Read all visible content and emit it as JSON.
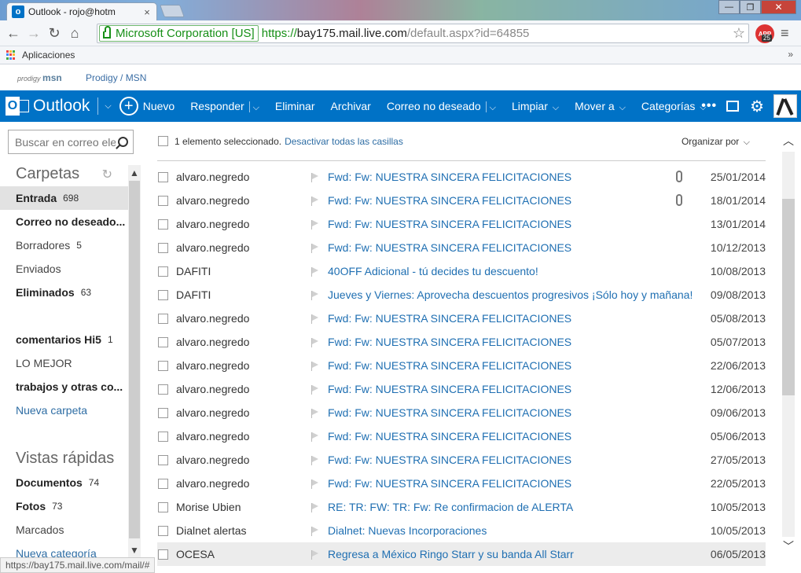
{
  "browser": {
    "tab_title": "Outlook -     rojo@hotm",
    "tab_close": "×",
    "window_controls": {
      "minimize": "—",
      "maximize": "❐",
      "close": "✕"
    },
    "nav": {
      "back": "←",
      "forward": "→",
      "reload": "↻",
      "home": "⌂"
    },
    "ev_label": "Microsoft Corporation [US]",
    "url_scheme": "https://",
    "url_host": "bay175.mail.live.com",
    "url_path": "/default.aspx?id=64855",
    "star": "☆",
    "ext_label": "APP",
    "ext_badge": "25",
    "menu": "≡",
    "bookmarks_apps": "Aplicaciones",
    "bookmarks_overflow": "»",
    "status_url": "https://bay175.mail.live.com/mail/#"
  },
  "portal": {
    "logo_small": "prodigy",
    "logo_brand": "msn",
    "link": "Prodigy / MSN"
  },
  "outlook": {
    "brand": "Outlook",
    "new_label": "Nuevo",
    "commands": [
      {
        "label": "Responder",
        "split": true
      },
      {
        "label": "Eliminar",
        "split": false
      },
      {
        "label": "Archivar",
        "split": false
      },
      {
        "label": "Correo no deseado",
        "split": true
      },
      {
        "label": "Limpiar",
        "split": false,
        "dropdown": true
      },
      {
        "label": "Mover a",
        "split": false,
        "dropdown": true
      },
      {
        "label": "Categorías",
        "split": false,
        "dropdown": true
      }
    ],
    "more": "•••",
    "gear": "⚙"
  },
  "sidebar": {
    "search_placeholder": "Buscar en correo electrónico",
    "folders_title": "Carpetas",
    "refresh": "↻",
    "folders": [
      {
        "label": "Entrada",
        "count": "698",
        "style": "sel"
      },
      {
        "label": "Correo no deseado...",
        "count": "",
        "style": "bold"
      },
      {
        "label": "Borradores",
        "count": "5",
        "style": ""
      },
      {
        "label": "Enviados",
        "count": "",
        "style": ""
      },
      {
        "label": "Eliminados",
        "count": "63",
        "style": "bold"
      }
    ],
    "custom_folders": [
      {
        "label": "comentarios Hi5",
        "count": "1",
        "style": "bold"
      },
      {
        "label": "LO MEJOR",
        "count": "",
        "style": ""
      },
      {
        "label": "trabajos y otras co...",
        "count": "",
        "style": "bold"
      }
    ],
    "new_folder": "Nueva carpeta",
    "quick_views_title": "Vistas rápidas",
    "quick_views": [
      {
        "label": "Documentos",
        "count": "74",
        "style": "bold"
      },
      {
        "label": "Fotos",
        "count": "73",
        "style": "bold"
      },
      {
        "label": "Marcados",
        "count": "",
        "style": ""
      }
    ],
    "new_category": "Nueva categoría",
    "scroll_up": "▲",
    "scroll_down": "▼"
  },
  "list": {
    "selection_text": "1 elemento seleccionado.",
    "deselect_link": "Desactivar todas las casillas",
    "organize_label": "Organizar por",
    "scroll_up": "︿",
    "scroll_down": "﹀",
    "rows": [
      {
        "from": "alvaro.negredo",
        "subject": "Fwd: Fw: NUESTRA SINCERA FELICITACIONES",
        "date": "25/01/2014",
        "attachment": true
      },
      {
        "from": "alvaro.negredo",
        "subject": "Fwd: Fw: NUESTRA SINCERA FELICITACIONES",
        "date": "18/01/2014",
        "attachment": true
      },
      {
        "from": "alvaro.negredo",
        "subject": "Fwd: Fw: NUESTRA SINCERA FELICITACIONES",
        "date": "13/01/2014",
        "attachment": false
      },
      {
        "from": "alvaro.negredo",
        "subject": "Fwd: Fw: NUESTRA SINCERA FELICITACIONES",
        "date": "10/12/2013",
        "attachment": false
      },
      {
        "from": "DAFITI",
        "subject": "40OFF Adicional - tú decides tu descuento!",
        "date": "10/08/2013",
        "attachment": false
      },
      {
        "from": "DAFITI",
        "subject": "Jueves y Viernes: Aprovecha descuentos progresivos ¡Sólo hoy y mañana!",
        "date": "09/08/2013",
        "attachment": false
      },
      {
        "from": "alvaro.negredo",
        "subject": "Fwd: Fw: NUESTRA SINCERA FELICITACIONES",
        "date": "05/08/2013",
        "attachment": false
      },
      {
        "from": "alvaro.negredo",
        "subject": "Fwd: Fw: NUESTRA SINCERA FELICITACIONES",
        "date": "05/07/2013",
        "attachment": false
      },
      {
        "from": "alvaro.negredo",
        "subject": "Fwd: Fw: NUESTRA SINCERA FELICITACIONES",
        "date": "22/06/2013",
        "attachment": false
      },
      {
        "from": "alvaro.negredo",
        "subject": "Fwd: Fw: NUESTRA SINCERA FELICITACIONES",
        "date": "12/06/2013",
        "attachment": false
      },
      {
        "from": "alvaro.negredo",
        "subject": "Fwd: Fw: NUESTRA SINCERA FELICITACIONES",
        "date": "09/06/2013",
        "attachment": false
      },
      {
        "from": "alvaro.negredo",
        "subject": "Fwd: Fw: NUESTRA SINCERA FELICITACIONES",
        "date": "05/06/2013",
        "attachment": false
      },
      {
        "from": "alvaro.negredo",
        "subject": "Fwd: Fw: NUESTRA SINCERA FELICITACIONES",
        "date": "27/05/2013",
        "attachment": false
      },
      {
        "from": "alvaro.negredo",
        "subject": "Fwd: Fw: NUESTRA SINCERA FELICITACIONES",
        "date": "22/05/2013",
        "attachment": false
      },
      {
        "from": "Morise Ubien",
        "subject": "RE: TR: FW: TR: Fw: Re confirmacion de ALERTA",
        "date": "10/05/2013",
        "attachment": false
      },
      {
        "from": "Dialnet alertas",
        "subject": "Dialnet: Nuevas Incorporaciones",
        "date": "10/05/2013",
        "attachment": false
      },
      {
        "from": "OCESA",
        "subject": "Regresa a México Ringo Starr y su banda All Starr",
        "date": "06/05/2013",
        "attachment": false
      }
    ]
  },
  "colors": {
    "outlook_blue": "#0072c6",
    "link_blue": "#1f6fb2",
    "ev_green": "#168f16"
  }
}
